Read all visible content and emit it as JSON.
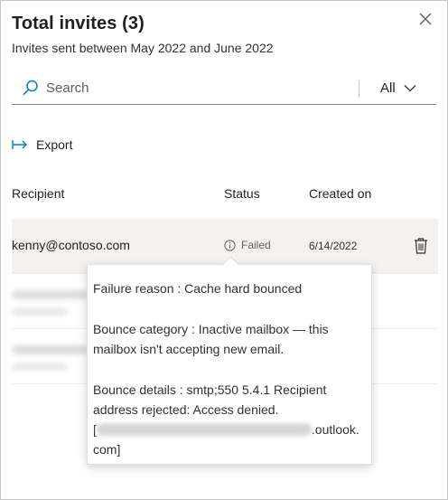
{
  "header": {
    "title": "Total invites (3)",
    "subtitle": "Invites sent between May 2022 and June 2022"
  },
  "search": {
    "placeholder": "Search",
    "icon": "search-icon"
  },
  "filter": {
    "selected": "All",
    "icon": "chevron-down-icon"
  },
  "toolbar": {
    "export_label": "Export",
    "export_icon": "export-arrow-icon"
  },
  "table": {
    "columns": [
      "Recipient",
      "Status",
      "Created on"
    ],
    "rows": [
      {
        "recipient": "kenny@contoso.com",
        "status": "Failed",
        "created_on": "6/14/2022",
        "status_icon": "info-icon",
        "action_icon": "trash-icon"
      }
    ]
  },
  "tooltip": {
    "failure_reason": "Failure reason : Cache hard bounced",
    "bounce_category_line1": "Bounce category : Inactive mailbox — this",
    "bounce_category_line2": "mailbox isn't accepting new email.",
    "bounce_details_line1": "Bounce details : smtp;550 5.4.1 Recipient",
    "bounce_details_line2": "address rejected: Access denied.",
    "bounce_details_line3_prefix": "[",
    "bounce_details_line3_suffix": ".outlook.",
    "bounce_details_line4": "com]"
  },
  "colors": {
    "accent": "#0078d4",
    "selected_row": "#f3f2f1",
    "text": "#201f1e",
    "muted": "#605e5c"
  }
}
